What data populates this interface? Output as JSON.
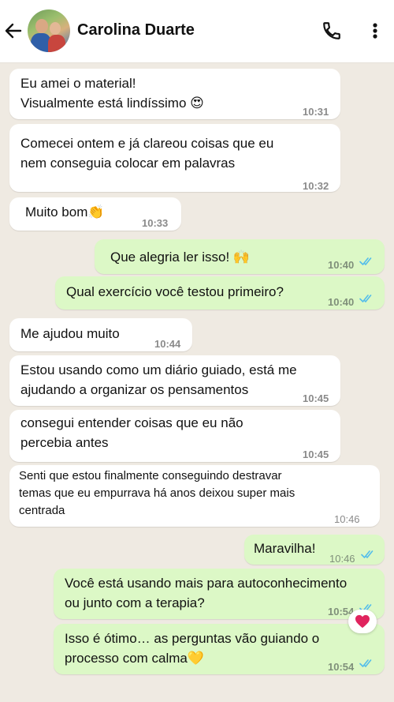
{
  "header": {
    "contact_name": "Carolina Duarte",
    "back_icon": "arrow-left-icon",
    "call_icon": "phone-icon",
    "menu_icon": "kebab-menu-icon"
  },
  "colors": {
    "incoming": "#ffffff",
    "outgoing": "#dcf8c6",
    "read_ticks": "#53bdeb",
    "background": "#efeae2"
  },
  "messages": [
    {
      "dir": "in",
      "text": "Eu amei o material!\nVisualmente está lindíssimo",
      "emoji": "😍",
      "time": "10:31"
    },
    {
      "dir": "in",
      "text": "Comecei ontem e já clareou coisas que eu\nnem conseguia colocar em palavras",
      "time": "10:32"
    },
    {
      "dir": "in",
      "text": "Muito bom",
      "emoji": "👏",
      "time": "10:33"
    },
    {
      "dir": "out",
      "text": "Que alegria ler isso!",
      "emoji": "🙌",
      "time": "10:40",
      "status": "read"
    },
    {
      "dir": "out",
      "text": "Qual exercício você testou primeiro?",
      "time": "10:40",
      "status": "read"
    },
    {
      "dir": "in",
      "text": "Me ajudou muito",
      "time": "10:44"
    },
    {
      "dir": "in",
      "text": "Estou usando como um diário guiado, está me\najudando a organizar os pensamentos",
      "time": "10:45"
    },
    {
      "dir": "in",
      "text": "consegui entender coisas que eu não\npercebia antes",
      "time": "10:45"
    },
    {
      "dir": "in",
      "text": "Senti que estou finalmente conseguindo destravar\ntemas que eu empurrava há anos deixou super mais\ncentrada",
      "time": "10:46"
    },
    {
      "dir": "out",
      "text": "Maravilha!",
      "time": "10:46",
      "status": "read"
    },
    {
      "dir": "out",
      "text": "Você está usando mais para autoconhecimento\nou junto com a terapia?",
      "time": "10:54",
      "status": "read"
    },
    {
      "dir": "out",
      "text": "Isso é ótimo… as perguntas vão guiando o\nprocesso com calma",
      "emoji": "💛",
      "time": "10:54",
      "status": "read"
    }
  ],
  "reaction": {
    "emoji": "❤️",
    "icon": "heart-icon"
  }
}
